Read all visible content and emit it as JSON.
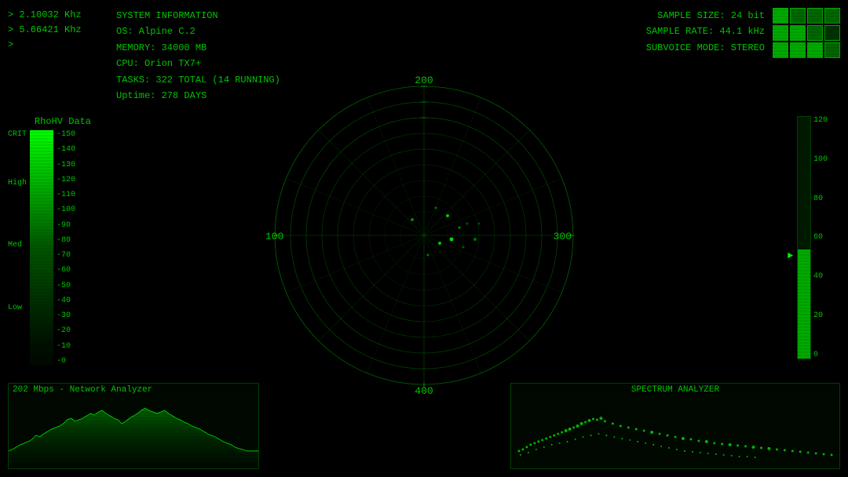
{
  "frequencies": {
    "items": [
      {
        "label": "> 2.10032 Khz"
      },
      {
        "label": "> 5.66421 Khz"
      },
      {
        "label": ">"
      }
    ]
  },
  "sysinfo": {
    "title": "SYSTEM INFORMATION",
    "os": "OS: Alpine C.2",
    "memory": "MEMORY: 34000 MB",
    "cpu": "CPU: Orion TX7+",
    "tasks": "TASKS: 322 TOTAL (14 RUNNING)",
    "uptime": "Uptime: 278 DAYS"
  },
  "sample": {
    "size": "SAMPLE SIZE: 24 bit",
    "rate": "SAMPLE RATE: 44.1 kHz",
    "mode": "SUBVOICE MODE: STEREO"
  },
  "legend": {
    "title": "RhoHV Data",
    "labels_left": [
      "CRIT",
      "",
      "",
      "High",
      "",
      "",
      "",
      "",
      "",
      "Med",
      "",
      "",
      "",
      "",
      "",
      "",
      "",
      "",
      "",
      "Low",
      ""
    ],
    "labels_right": [
      "-150",
      "-140",
      "-130",
      "-120",
      "-110",
      "-100",
      "-90",
      "-80",
      "-70",
      "-60",
      "-50",
      "-40",
      "-30",
      "-20",
      "-10",
      "-0"
    ]
  },
  "radar": {
    "labels": {
      "top": "200",
      "right": "300",
      "bottom": "400",
      "left": "100"
    }
  },
  "scale": {
    "labels": [
      "120",
      "100",
      "80",
      "60",
      "40",
      "20",
      "0"
    ]
  },
  "network": {
    "title": "202 Mbps - Network Analyzer"
  },
  "spectrum": {
    "title": "SPECTRUM ANALYZER"
  },
  "colors": {
    "green_bright": "#00ff00",
    "green_mid": "#00cc00",
    "green_dark": "#004400",
    "bg": "#000000"
  }
}
